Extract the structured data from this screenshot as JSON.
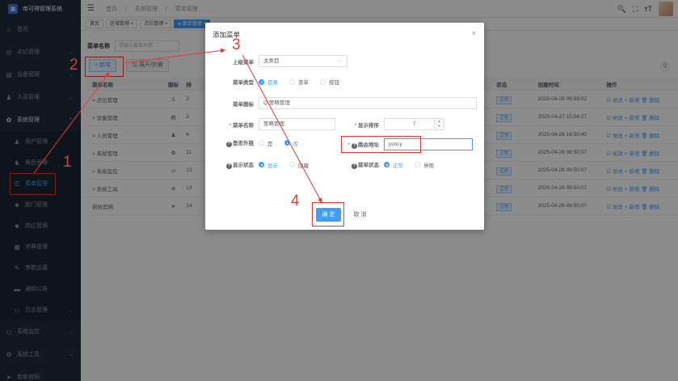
{
  "app": {
    "title": "帝可得管理系统"
  },
  "sidebar": {
    "items": [
      {
        "label": "首页",
        "icon": "home-icon",
        "glyph": "⌂"
      },
      {
        "label": "点位管理",
        "icon": "location-icon",
        "glyph": "◎",
        "chevron": "⌄"
      },
      {
        "label": "设备管理",
        "icon": "device-icon",
        "glyph": "▤",
        "chevron": "⌄"
      },
      {
        "label": "人员管理",
        "icon": "user-icon",
        "glyph": "♟",
        "chevron": "⌄"
      },
      {
        "label": "系统管理",
        "icon": "gear-icon",
        "glyph": "✿",
        "chevron": "⌃"
      }
    ],
    "submenu": [
      {
        "label": "用户管理",
        "icon": "user-icon",
        "glyph": "♟"
      },
      {
        "label": "角色管理",
        "icon": "role-icon",
        "glyph": "♞"
      },
      {
        "label": "菜单管理",
        "icon": "tree-menu-icon",
        "glyph": "☰",
        "active": true
      },
      {
        "label": "部门管理",
        "icon": "dept-icon",
        "glyph": "♣"
      },
      {
        "label": "岗位管理",
        "icon": "post-icon",
        "glyph": "■"
      },
      {
        "label": "字典管理",
        "icon": "dict-icon",
        "glyph": "▦"
      },
      {
        "label": "参数设置",
        "icon": "edit-icon",
        "glyph": "✎"
      },
      {
        "label": "通知公告",
        "icon": "message-icon",
        "glyph": "▬"
      },
      {
        "label": "日志管理",
        "icon": "log-icon",
        "glyph": "▭",
        "chevron": "⌄"
      }
    ],
    "bottom": [
      {
        "label": "系统监控",
        "icon": "monitor-icon",
        "glyph": "▭",
        "chevron": "⌄"
      },
      {
        "label": "系统工具",
        "icon": "tool-icon",
        "glyph": "⚙",
        "chevron": "⌄"
      },
      {
        "label": "若依官网",
        "icon": "guide-icon",
        "glyph": "➤"
      }
    ]
  },
  "topbar": {
    "hamburger": "☰",
    "breadcrumb": [
      "首页",
      "系统管理",
      "菜单管理"
    ],
    "sep": "/",
    "icons": {
      "search": "🔍",
      "fullscreen": "⛶",
      "size": "тT"
    }
  },
  "tags": [
    "首页",
    "区域管理 ×",
    "点位管理 ×",
    "● 菜单管理 ×"
  ],
  "search": {
    "label": "菜单名称",
    "placeholder": "请输入菜单名称"
  },
  "toolbar": {
    "add": "+ 新增",
    "expand": "⇅ 展开/折叠",
    "refresh": "Q"
  },
  "table": {
    "headers": {
      "name": "菜单名称",
      "icon": "图标",
      "order": "排",
      "status": "状态",
      "time": "创建时间",
      "ops": "操作"
    },
    "rows": [
      {
        "name": "> 点位管理",
        "icon": "♙",
        "order": "2",
        "status": "正常",
        "time": "2025-04-26 09:58:02",
        "ops": "☑ 修改   + 新增   🗑 删除"
      },
      {
        "name": "> 设备管理",
        "icon": "▤",
        "order": "3",
        "status": "正常",
        "time": "2025-04-27 15:54:27",
        "ops": "☑ 修改   + 新增   🗑 删除"
      },
      {
        "name": "> 人员管理",
        "icon": "♟",
        "order": "4",
        "status": "正常",
        "time": "2025-04-26 16:50:40",
        "ops": "☑ 修改   + 新增   🗑 删除"
      },
      {
        "name": "> 系统管理",
        "icon": "✿",
        "order": "11",
        "status": "正常",
        "time": "2025-04-26 08:50:07",
        "ops": "☑ 修改   + 新增   🗑 删除"
      },
      {
        "name": "> 系统监控",
        "icon": "▭",
        "order": "13",
        "status": "正常",
        "time": "2025-04-26 08:50:07",
        "ops": "☑ 修改   + 新增   🗑 删除"
      },
      {
        "name": "> 系统工具",
        "icon": "⊕",
        "order": "13",
        "status": "正常",
        "time": "2025-04-26 08:50:07",
        "ops": "☑ 修改   + 新增   🗑 删除"
      },
      {
        "name": "若依官网",
        "icon": "➤",
        "order": "14",
        "status": "正常",
        "time": "2025-04-26 08:50:07",
        "ops": "☑ 修改   + 新增   🗑 删除"
      }
    ]
  },
  "dialog": {
    "title": "添加菜单",
    "close": "×",
    "parent": {
      "label": "上级菜单",
      "value": "主类目",
      "arrow": "⌄"
    },
    "type": {
      "label": "菜单类型",
      "options": [
        "目录",
        "菜单",
        "按钮"
      ]
    },
    "icon": {
      "label": "菜单图标",
      "value": "Q 策略管理"
    },
    "name": {
      "req": "*",
      "label": "菜单名称",
      "value": "策略管理"
    },
    "order": {
      "req": "*",
      "label": "显示排序",
      "value": "7",
      "up": "▲",
      "down": "▼"
    },
    "external": {
      "q": "?",
      "label": "是否外链",
      "options": [
        "是",
        "否"
      ]
    },
    "path": {
      "req": "*",
      "q": "?",
      "label": "路由地址",
      "value": "policy"
    },
    "visible": {
      "q": "?",
      "label": "显示状态",
      "options": [
        "显示",
        "隐藏"
      ]
    },
    "status": {
      "q": "?",
      "label": "菜单状态",
      "options": [
        "正常",
        "停用"
      ]
    },
    "confirm": "确 定",
    "cancel": "取 消"
  },
  "annotations": [
    "1",
    "2",
    "3",
    "4"
  ]
}
